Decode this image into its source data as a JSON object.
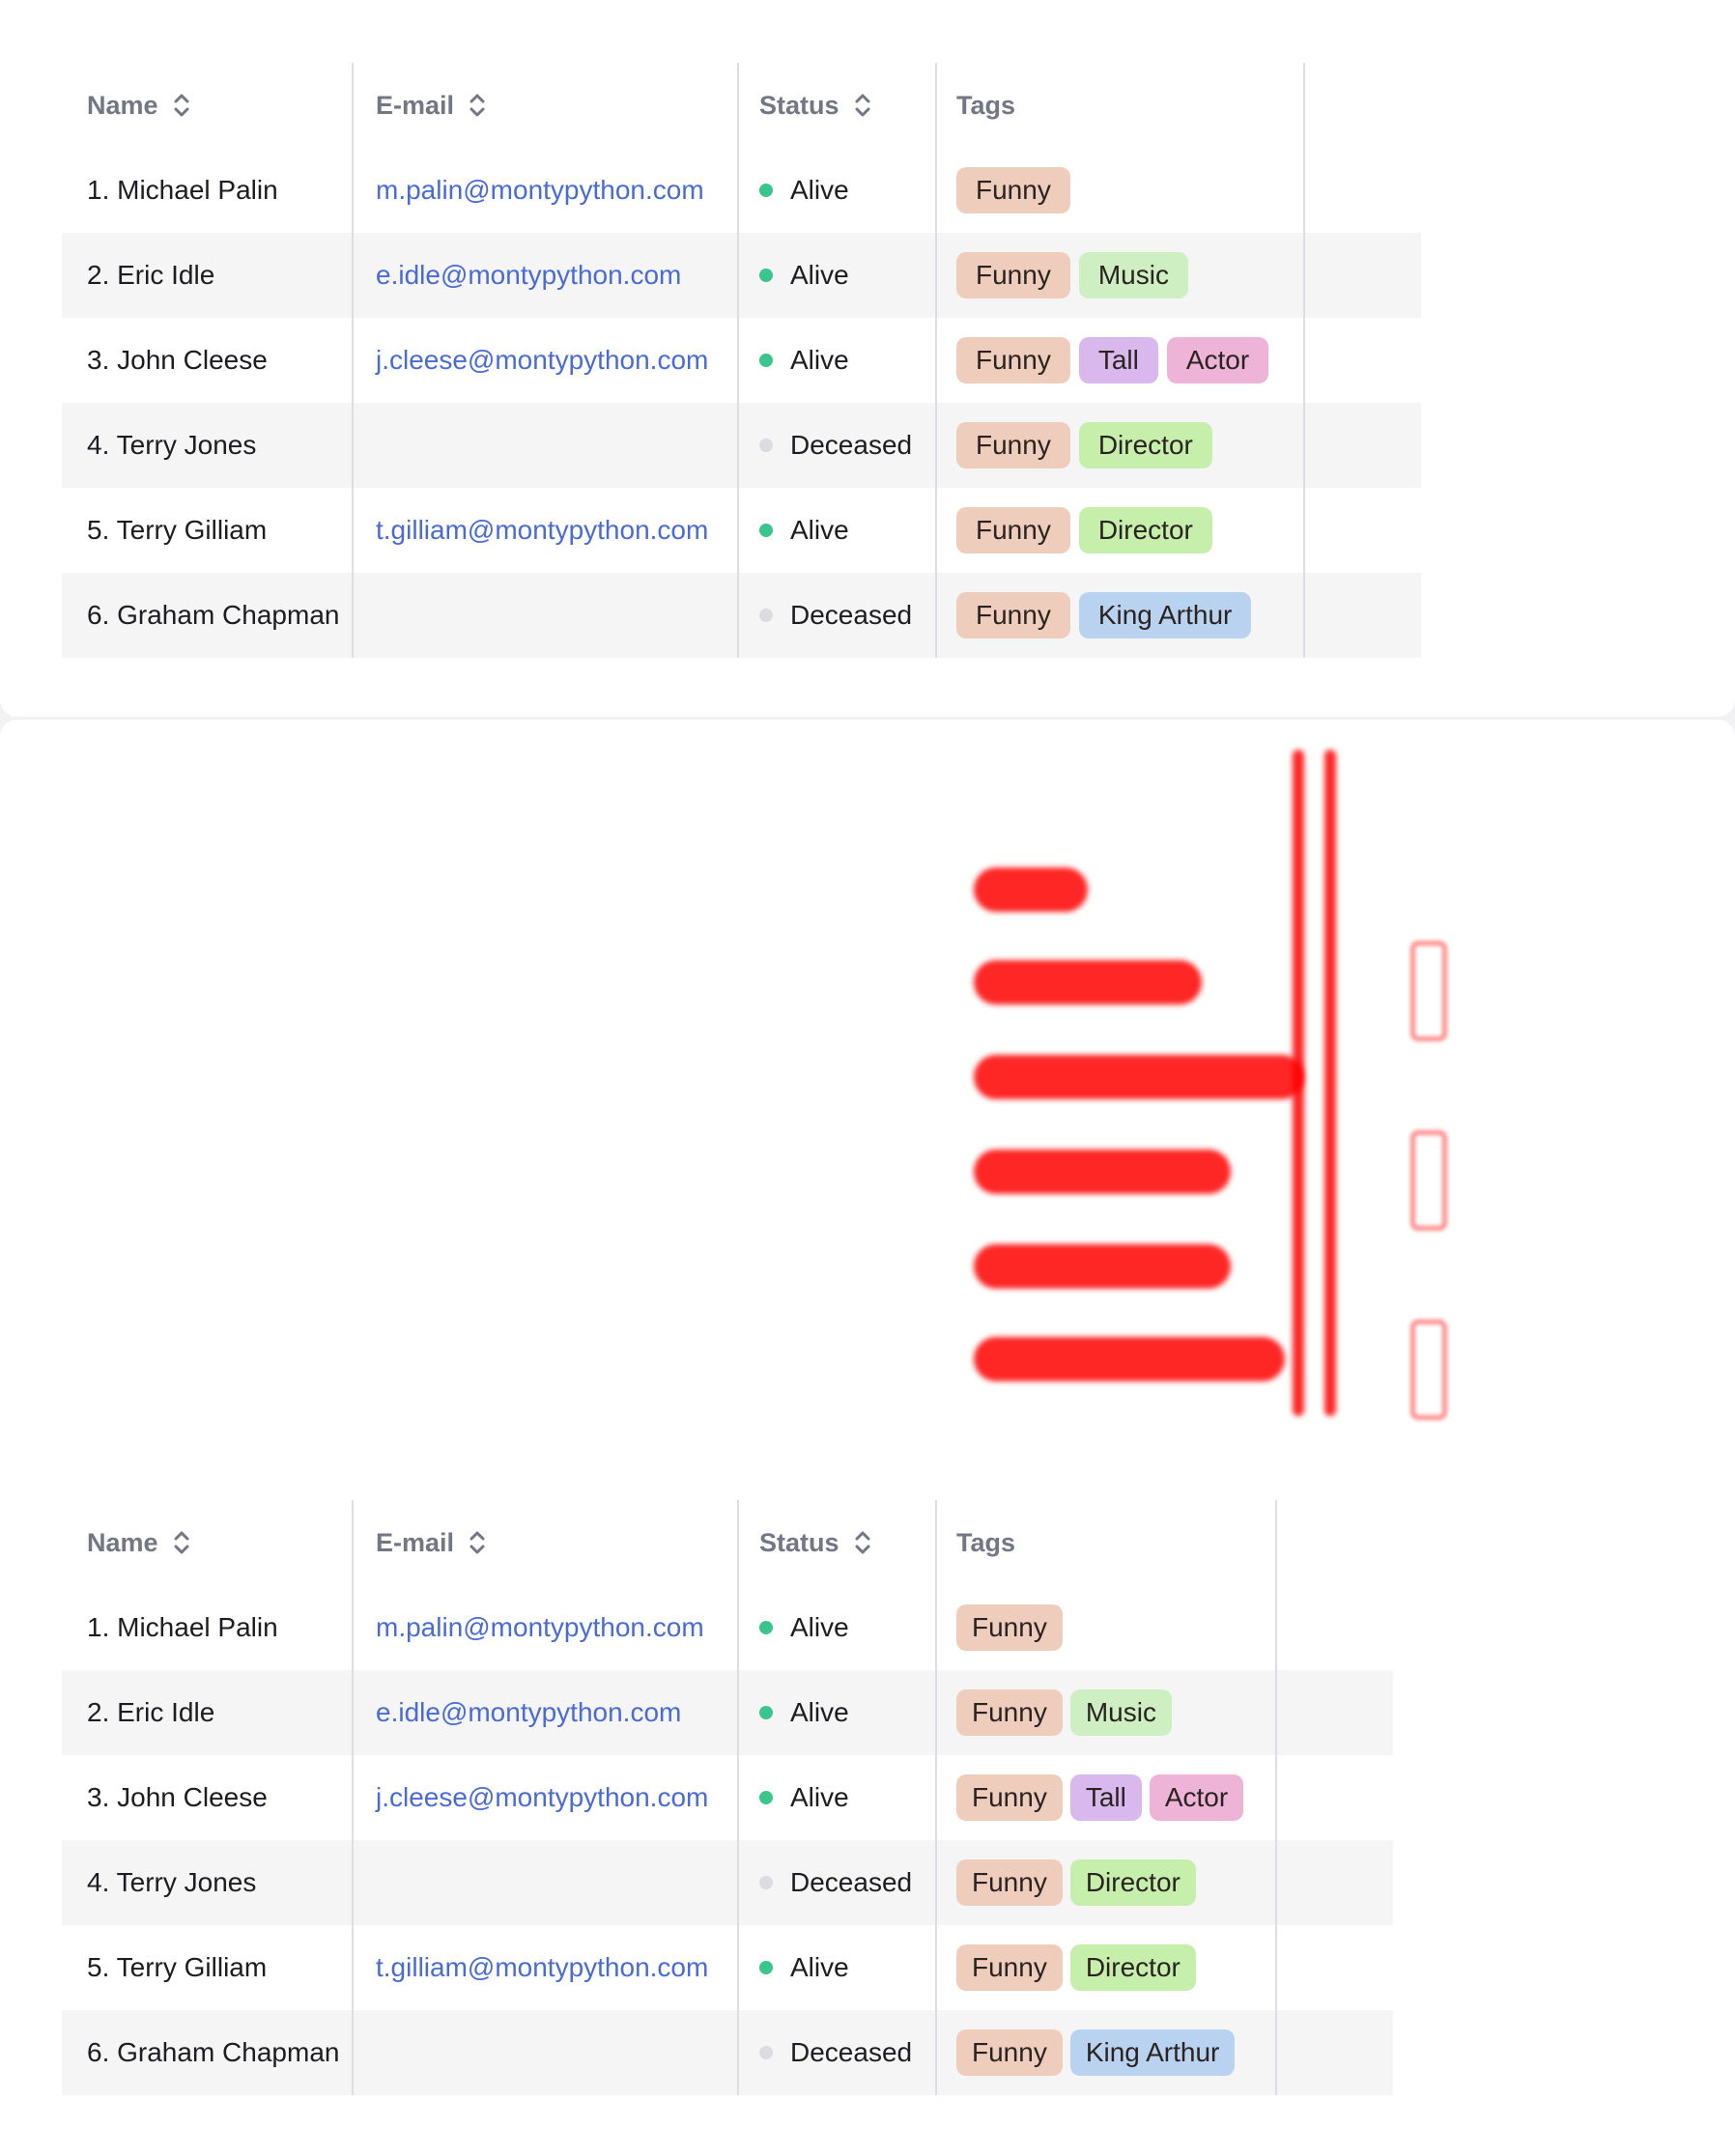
{
  "colors": {
    "alive": "#3cc48f",
    "deceased": "#dcdce0",
    "email": "#4a6ad6",
    "header_text": "#737683",
    "diff": "#ff0000"
  },
  "tag_colors": {
    "Funny": "#efcdbd",
    "Music": "#cdefc1",
    "Tall": "#d9b8ee",
    "Actor": "#eeb4d8",
    "Director": "#c6efac",
    "King Arthur": "#b8d2ef"
  },
  "headers": {
    "name": "Name",
    "email": "E-mail",
    "status": "Status",
    "tags": "Tags"
  },
  "rows": [
    {
      "name": "1. Michael Palin",
      "email": "m.palin@montypython.com",
      "status": "Alive",
      "tags": [
        "Funny"
      ]
    },
    {
      "name": "2. Eric Idle",
      "email": "e.idle@montypython.com",
      "status": "Alive",
      "tags": [
        "Funny",
        "Music"
      ]
    },
    {
      "name": "3. John Cleese",
      "email": "j.cleese@montypython.com",
      "status": "Alive",
      "tags": [
        "Funny",
        "Tall",
        "Actor"
      ]
    },
    {
      "name": "4. Terry Jones",
      "email": "",
      "status": "Deceased",
      "tags": [
        "Funny",
        "Director"
      ]
    },
    {
      "name": "5. Terry Gilliam",
      "email": "t.gilliam@montypython.com",
      "status": "Alive",
      "tags": [
        "Funny",
        "Director"
      ]
    },
    {
      "name": "6. Graham Chapman",
      "email": "",
      "status": "Deceased",
      "tags": [
        "Funny",
        "King Arthur"
      ]
    }
  ]
}
